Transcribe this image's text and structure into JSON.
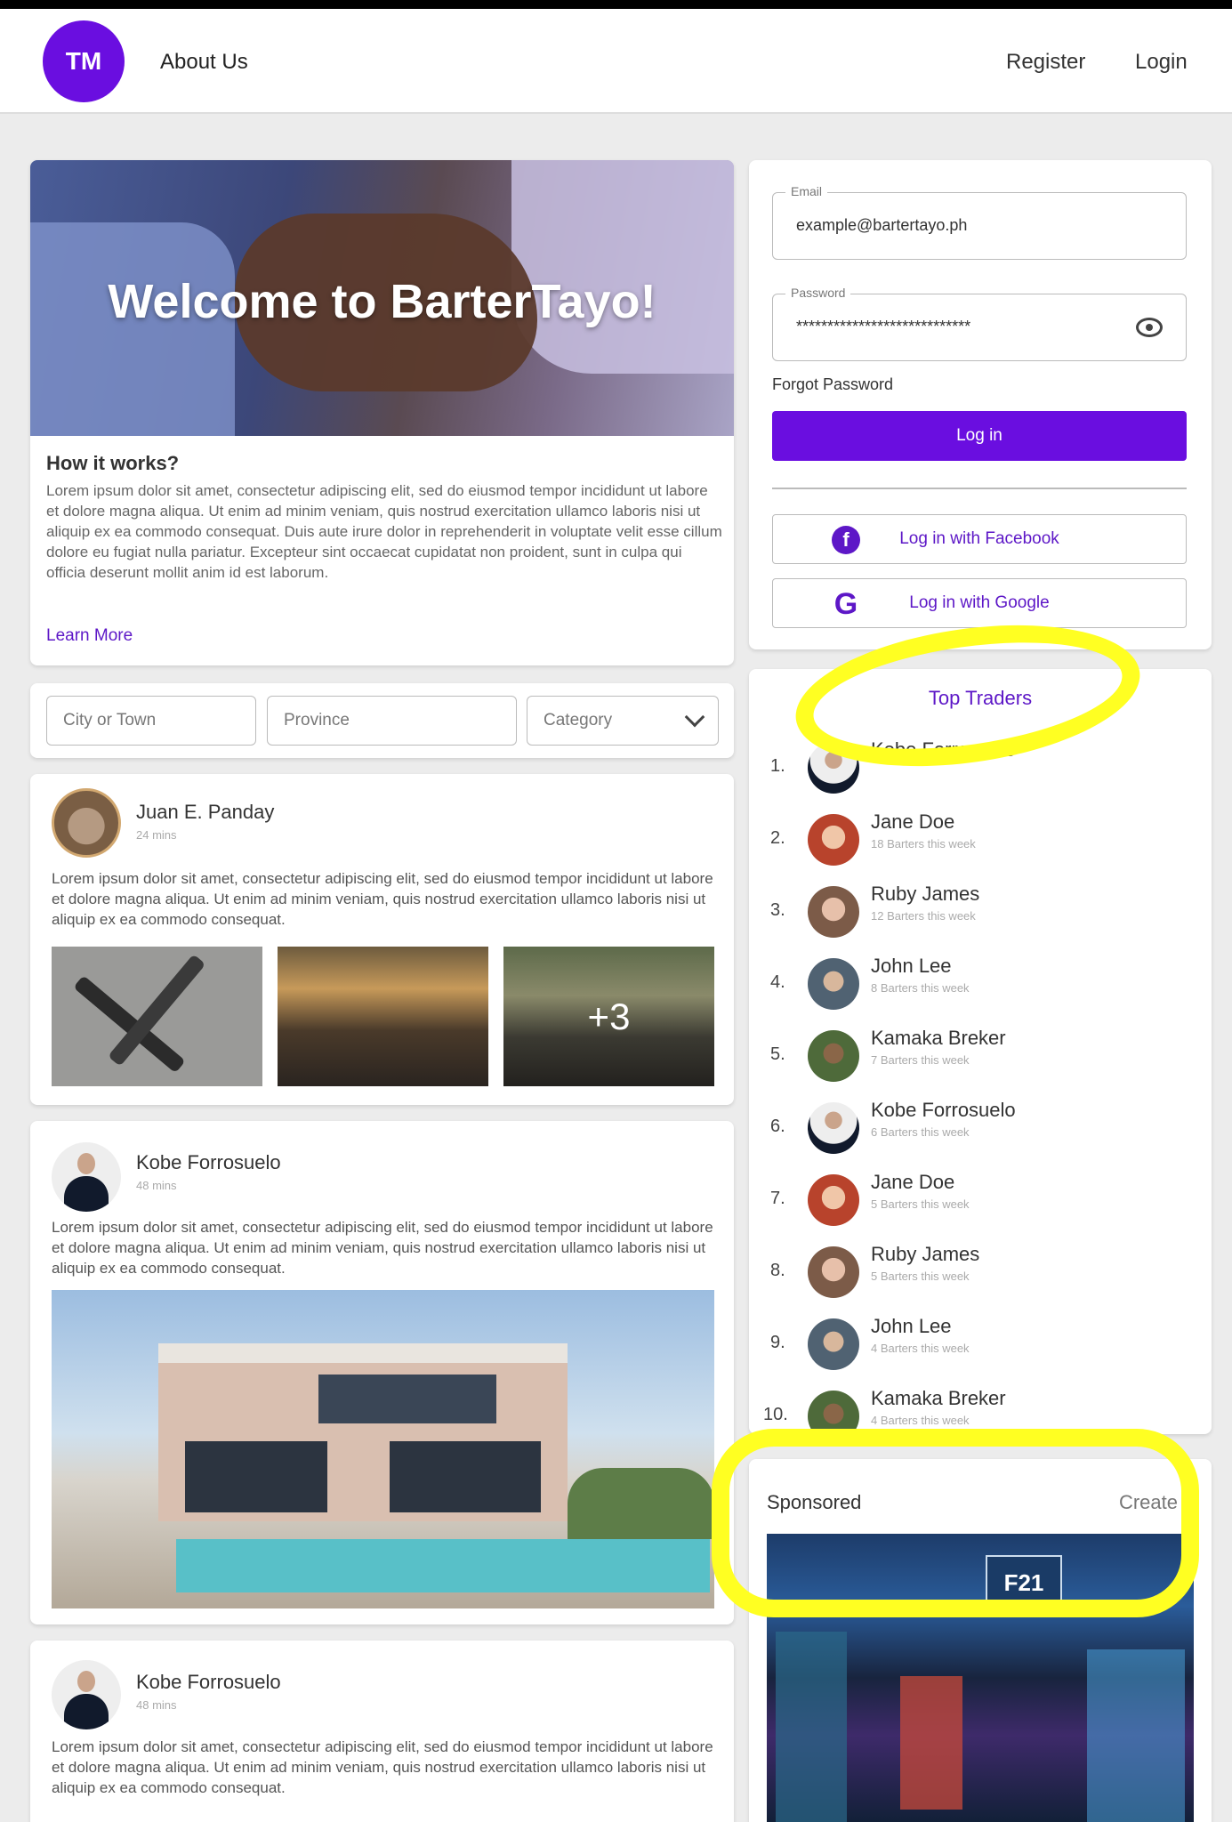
{
  "header": {
    "logo_text": "TM",
    "about": "About Us",
    "register": "Register",
    "login": "Login"
  },
  "welcome": {
    "hero_title": "Welcome to BarterTayo!",
    "how_title": "How it works?",
    "how_body": "Lorem ipsum dolor sit amet, consectetur adipiscing elit, sed do eiusmod tempor incididunt ut labore et dolore magna aliqua. Ut enim ad minim veniam, quis nostrud exercitation ullamco laboris nisi ut aliquip ex ea commodo consequat. Duis aute irure dolor in reprehenderit in voluptate velit esse cillum dolore eu fugiat nulla pariatur. Excepteur sint occaecat cupidatat non proident, sunt in culpa qui officia deserunt mollit anim id est laborum.",
    "learn_more": "Learn More"
  },
  "filters": {
    "city_placeholder": "City or Town",
    "province_placeholder": "Province",
    "category_placeholder": "Category"
  },
  "posts": [
    {
      "name": "Juan E. Panday",
      "time": "24 mins",
      "body": "Lorem ipsum dolor sit amet, consectetur adipiscing elit, sed do eiusmod tempor incididunt ut labore et dolore magna aliqua. Ut enim ad minim veniam, quis nostrud exercitation ullamco laboris nisi ut aliquip ex ea commodo consequat.",
      "more_images": "+3"
    },
    {
      "name": "Kobe Forrosuelo",
      "time": "48 mins",
      "body": "Lorem ipsum dolor sit amet, consectetur adipiscing elit, sed do eiusmod tempor incididunt ut labore et dolore magna aliqua. Ut enim ad minim veniam, quis nostrud exercitation ullamco laboris nisi ut aliquip ex ea commodo consequat."
    },
    {
      "name": "Kobe Forrosuelo",
      "time": "48 mins",
      "body": "Lorem ipsum dolor sit amet, consectetur adipiscing elit, sed do eiusmod tempor incididunt ut labore et dolore magna aliqua. Ut enim ad minim veniam, quis nostrud exercitation ullamco laboris nisi ut aliquip ex ea commodo consequat."
    }
  ],
  "login": {
    "email_label": "Email",
    "email_value": "example@bartertayo.ph",
    "password_label": "Password",
    "password_value": "****************************",
    "forgot": "Forgot Password",
    "login_button": "Log in",
    "facebook_button": "Log in with Facebook",
    "google_button": "Log in with Google"
  },
  "top_traders": {
    "title": "Top Traders",
    "items": [
      {
        "rank": "1.",
        "name": "Kobe Forrosuelo",
        "sub": ""
      },
      {
        "rank": "2.",
        "name": "Jane Doe",
        "sub": "18 Barters this week"
      },
      {
        "rank": "3.",
        "name": "Ruby James",
        "sub": "12 Barters this week"
      },
      {
        "rank": "4.",
        "name": "John Lee",
        "sub": "8 Barters this week"
      },
      {
        "rank": "5.",
        "name": "Kamaka Breker",
        "sub": "7 Barters this week"
      },
      {
        "rank": "6.",
        "name": "Kobe Forrosuelo",
        "sub": "6 Barters this week"
      },
      {
        "rank": "7.",
        "name": "Jane Doe",
        "sub": "5 Barters this week"
      },
      {
        "rank": "8.",
        "name": "Ruby James",
        "sub": "5 Barters this week"
      },
      {
        "rank": "9.",
        "name": "John Lee",
        "sub": "4 Barters this week"
      },
      {
        "rank": "10.",
        "name": "Kamaka Breker",
        "sub": "4 Barters this week"
      }
    ]
  },
  "sponsored": {
    "title": "Sponsored",
    "create": "Create",
    "sign_text": "F21"
  },
  "colors": {
    "brand": "#6a0ee0",
    "link": "#5d17c7",
    "highlight": "#ffff22"
  },
  "icons": [
    "eye-icon",
    "facebook-icon",
    "google-icon",
    "chevron-down-icon"
  ]
}
